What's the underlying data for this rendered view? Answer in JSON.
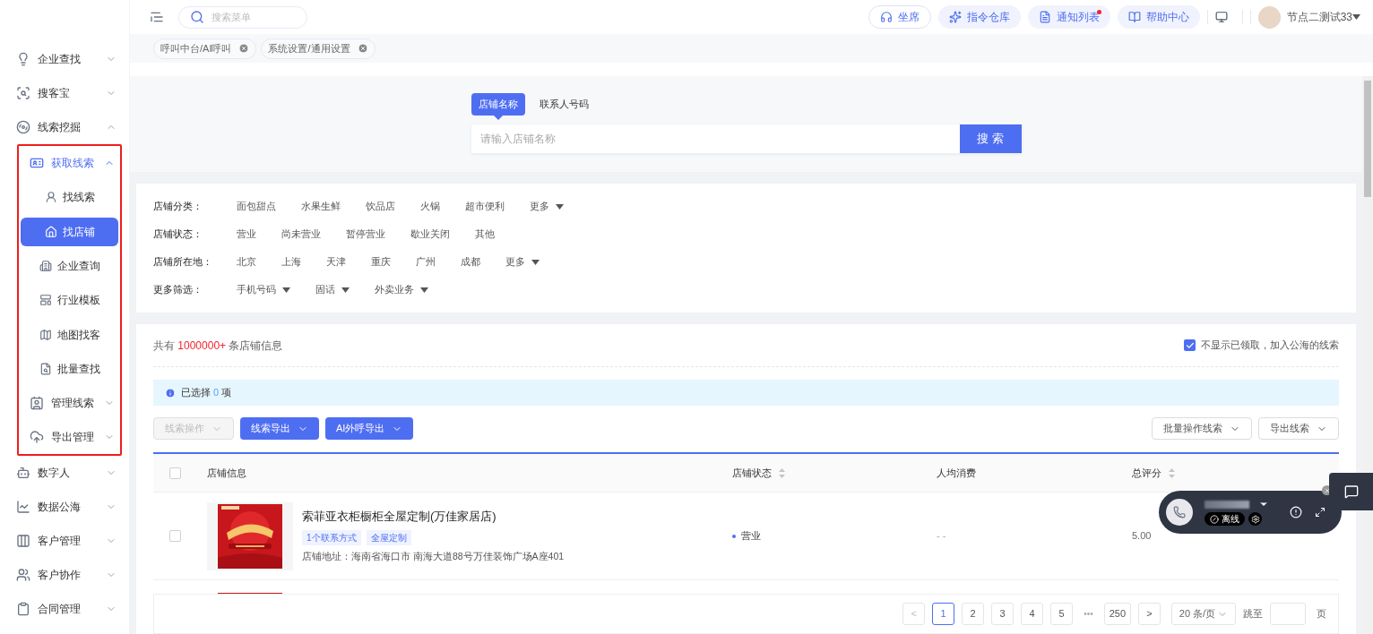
{
  "sidebar": {
    "items": [
      {
        "label": "企业查找",
        "expanded": false
      },
      {
        "label": "搜客宝",
        "expanded": false
      },
      {
        "label": "线索挖掘",
        "expanded": true,
        "outlined": true,
        "children": [
          {
            "label": "获取线索",
            "expanded": true,
            "children": [
              {
                "label": "找线索",
                "selected": false
              },
              {
                "label": "找店铺",
                "selected": true
              },
              {
                "label": "企业查询",
                "selected": false
              },
              {
                "label": "行业模板",
                "selected": false
              },
              {
                "label": "地图找客",
                "selected": false
              },
              {
                "label": "批量查找",
                "selected": false
              }
            ]
          },
          {
            "label": "管理线索",
            "expanded": false
          },
          {
            "label": "导出管理",
            "expanded": false
          }
        ]
      },
      {
        "label": "数字人",
        "expanded": false
      },
      {
        "label": "数据公海",
        "expanded": false
      },
      {
        "label": "客户管理",
        "expanded": false
      },
      {
        "label": "客户协作",
        "expanded": false
      },
      {
        "label": "合同管理",
        "expanded": false
      }
    ]
  },
  "topbar": {
    "search_placeholder": "搜索菜单",
    "buttons": [
      {
        "label": "坐席",
        "badge": false,
        "outlined": true
      },
      {
        "label": "指令仓库",
        "badge": false,
        "outlined": false
      },
      {
        "label": "通知列表",
        "badge": true,
        "outlined": false
      },
      {
        "label": "帮助中心",
        "badge": false,
        "outlined": false
      }
    ],
    "user": "节点二测试33"
  },
  "open_tabs": [
    "呼叫中台/AI呼叫",
    "系统设置/通用设置"
  ],
  "search": {
    "tabs": [
      {
        "label": "店铺名称",
        "selected": true
      },
      {
        "label": "联系人号码",
        "selected": false
      }
    ],
    "placeholder": "请输入店铺名称",
    "button": "搜 索"
  },
  "filters": [
    {
      "label": "店铺分类：",
      "options": [
        {
          "label": "面包甜点",
          "dropdown": false
        },
        {
          "label": "水果生鲜",
          "dropdown": false
        },
        {
          "label": "饮品店",
          "dropdown": false
        },
        {
          "label": "火锅",
          "dropdown": false
        },
        {
          "label": "超市便利",
          "dropdown": false
        },
        {
          "label": "更多",
          "dropdown": true
        }
      ]
    },
    {
      "label": "店铺状态：",
      "options": [
        {
          "label": "营业",
          "dropdown": false
        },
        {
          "label": "尚未营业",
          "dropdown": false
        },
        {
          "label": "暂停营业",
          "dropdown": false
        },
        {
          "label": "歇业关闭",
          "dropdown": false
        },
        {
          "label": "其他",
          "dropdown": false
        }
      ]
    },
    {
      "label": "店铺所在地：",
      "options": [
        {
          "label": "北京",
          "dropdown": false
        },
        {
          "label": "上海",
          "dropdown": false
        },
        {
          "label": "天津",
          "dropdown": false
        },
        {
          "label": "重庆",
          "dropdown": false
        },
        {
          "label": "广州",
          "dropdown": false
        },
        {
          "label": "成都",
          "dropdown": false
        },
        {
          "label": "更多",
          "dropdown": true
        }
      ]
    },
    {
      "label": "更多筛选：",
      "options": [
        {
          "label": "手机号码",
          "dropdown": true
        },
        {
          "label": "固话",
          "dropdown": true
        },
        {
          "label": "外卖业务",
          "dropdown": true
        }
      ]
    }
  ],
  "results": {
    "prefix": "共有",
    "count": "1000000+",
    "suffix": "条店铺信息",
    "hide_claimed": {
      "label": "不显示已领取，加入公海的线索",
      "checked": true
    },
    "selection": {
      "prefix": "已选择",
      "count": "0",
      "suffix": "项"
    },
    "actions": [
      {
        "label": "线索操作",
        "disabled": true
      },
      {
        "label": "线索导出",
        "disabled": false
      },
      {
        "label": "AI外呼导出",
        "disabled": false
      }
    ],
    "right_actions": [
      "批量操作线索",
      "导出线索"
    ],
    "all_checked": false,
    "columns": [
      {
        "label": "店铺信息",
        "sortable": false
      },
      {
        "label": "店铺状态",
        "sortable": true
      },
      {
        "label": "人均消费",
        "sortable": false
      },
      {
        "label": "总评分",
        "sortable": true
      }
    ],
    "rows": [
      {
        "kind": "full",
        "checked": false,
        "name": "索菲亚衣柜橱柜全屋定制(万佳家居店)",
        "tags": [
          "1个联系方式",
          "全屋定制"
        ],
        "address": "店铺地址：海南省海口市 南海大道88号万佳装饰广场A座401",
        "status": "营业",
        "avg": "- -",
        "score": "5.00"
      },
      {
        "kind": "cut"
      }
    ]
  },
  "pagination": {
    "prev": "<",
    "pages": [
      {
        "label": "1",
        "selected": true
      },
      {
        "label": "2",
        "selected": false
      },
      {
        "label": "3",
        "selected": false
      },
      {
        "label": "4",
        "selected": false
      },
      {
        "label": "5",
        "selected": false
      }
    ],
    "ellipsis": "•••",
    "last": "250",
    "next": ">",
    "page_size": "20 条/页",
    "jump": "跳至",
    "unit": "页"
  },
  "call_widget": {
    "status": "离线"
  }
}
